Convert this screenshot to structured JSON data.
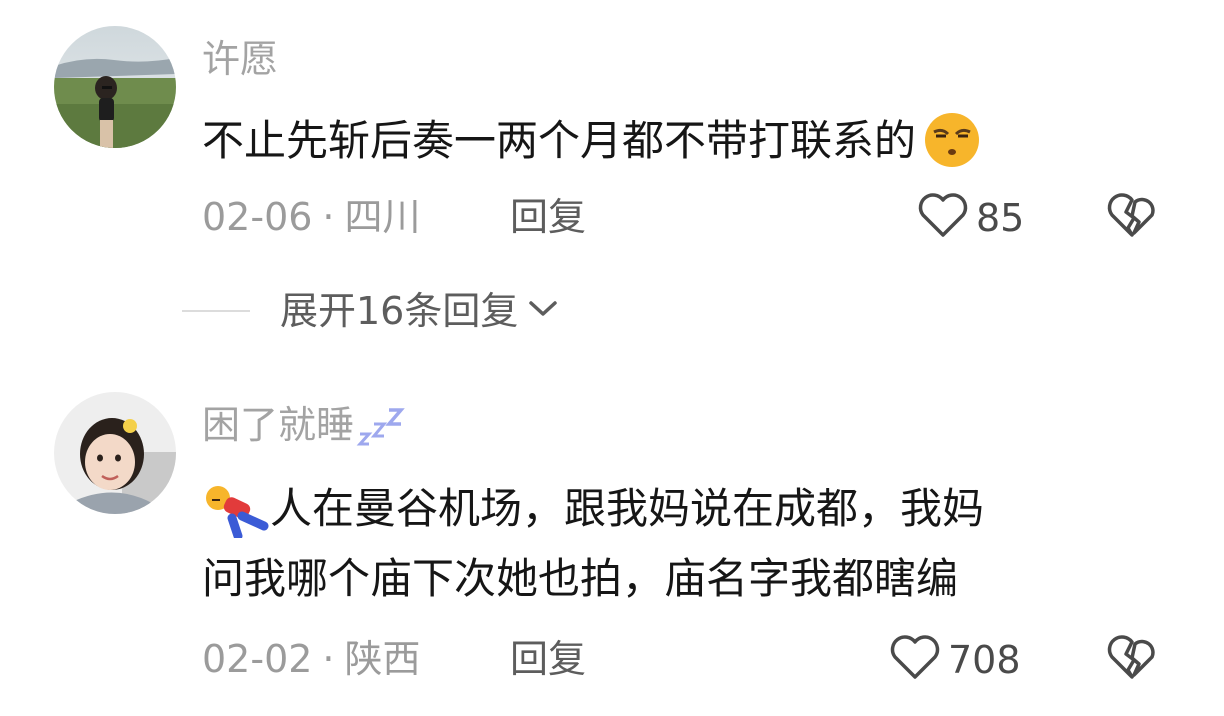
{
  "comments": [
    {
      "username": "许愿",
      "text_lines": [
        "不止先斩后奏一两个月都不带打联系的"
      ],
      "emoji": "smirk-face-emoji",
      "date": "02-06",
      "separator": "·",
      "location": "四川",
      "reply_label": "回复",
      "likes": "85",
      "expand_label": "展开16条回复"
    },
    {
      "username": "困了就睡",
      "username_suffix_icon": "zzz-sleep-icon",
      "leading_emoji": "sleeping-figure-emoji",
      "text_lines": [
        "人在曼谷机场，跟我妈说在成都，我妈",
        "问我哪个庙下次她也拍，庙名字我都瞎编"
      ],
      "date": "02-02",
      "separator": "·",
      "location": "陕西",
      "reply_label": "回复",
      "likes": "708"
    }
  ],
  "colors": {
    "username": "#a3a3a3",
    "content": "#161616",
    "meta": "#9b9b9b",
    "action": "#5d5d5d"
  }
}
